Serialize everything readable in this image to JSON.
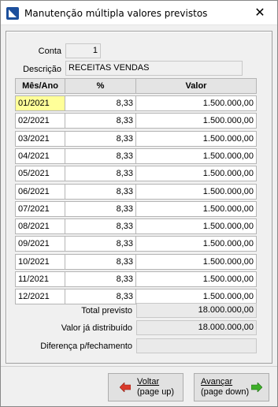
{
  "window": {
    "title": "Manutenção múltipla valores previstos",
    "close_glyph": "✕"
  },
  "form": {
    "conta_label": "Conta",
    "conta_value": "1",
    "descricao_label": "Descrição",
    "descricao_value": "RECEITAS VENDAS"
  },
  "grid": {
    "columns": [
      "Mês/Ano",
      "%",
      "Valor"
    ],
    "rows": [
      {
        "mes": "01/2021",
        "pct": "8,33",
        "valor": "1.500.000,00"
      },
      {
        "mes": "02/2021",
        "pct": "8,33",
        "valor": "1.500.000,00"
      },
      {
        "mes": "03/2021",
        "pct": "8,33",
        "valor": "1.500.000,00"
      },
      {
        "mes": "04/2021",
        "pct": "8,33",
        "valor": "1.500.000,00"
      },
      {
        "mes": "05/2021",
        "pct": "8,33",
        "valor": "1.500.000,00"
      },
      {
        "mes": "06/2021",
        "pct": "8,33",
        "valor": "1.500.000,00"
      },
      {
        "mes": "07/2021",
        "pct": "8,33",
        "valor": "1.500.000,00"
      },
      {
        "mes": "08/2021",
        "pct": "8,33",
        "valor": "1.500.000,00"
      },
      {
        "mes": "09/2021",
        "pct": "8,33",
        "valor": "1.500.000,00"
      },
      {
        "mes": "10/2021",
        "pct": "8,33",
        "valor": "1.500.000,00"
      },
      {
        "mes": "11/2021",
        "pct": "8,33",
        "valor": "1.500.000,00"
      },
      {
        "mes": "12/2021",
        "pct": "8,33",
        "valor": "1.500.000,00"
      }
    ]
  },
  "totals": {
    "total_previsto_label": "Total previsto",
    "total_previsto_value": "18.000.000,00",
    "valor_distribuido_label": "Valor já distribuído",
    "valor_distribuido_value": "18.000.000,00",
    "diferenca_label": "Diferença p/fechamento",
    "diferenca_value": ""
  },
  "buttons": {
    "voltar_label": "Voltar",
    "voltar_hint": "(page up)",
    "avancar_label": "Avançar",
    "avancar_hint": "(page down)"
  },
  "colors": {
    "selected_cell": "#ffff99",
    "arrow_back": "#d93a2b",
    "arrow_forward": "#3fae2a"
  },
  "icons": {
    "app": "app-icon",
    "back": "arrow-left-icon",
    "forward": "arrow-right-icon"
  }
}
